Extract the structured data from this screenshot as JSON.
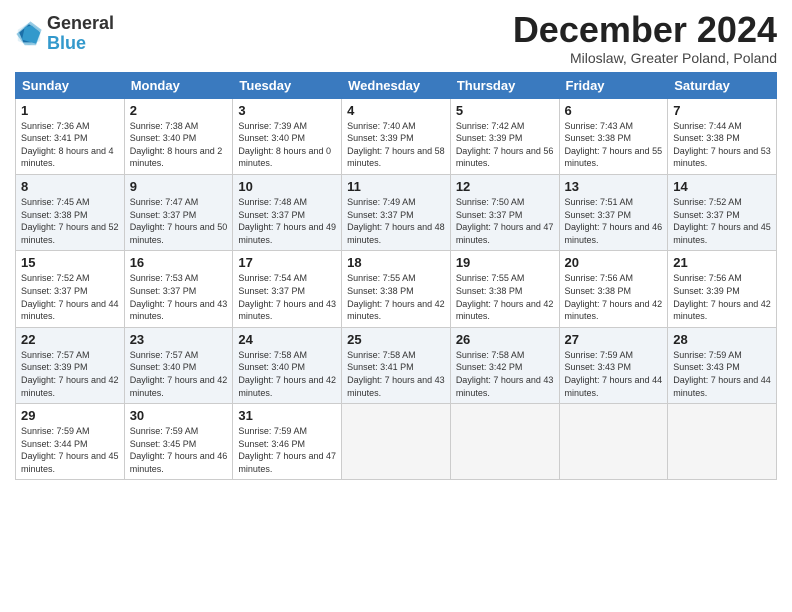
{
  "logo": {
    "general": "General",
    "blue": "Blue"
  },
  "header": {
    "month": "December 2024",
    "location": "Miloslaw, Greater Poland, Poland"
  },
  "weekdays": [
    "Sunday",
    "Monday",
    "Tuesday",
    "Wednesday",
    "Thursday",
    "Friday",
    "Saturday"
  ],
  "weeks": [
    [
      {
        "day": "1",
        "sunrise": "Sunrise: 7:36 AM",
        "sunset": "Sunset: 3:41 PM",
        "daylight": "Daylight: 8 hours and 4 minutes."
      },
      {
        "day": "2",
        "sunrise": "Sunrise: 7:38 AM",
        "sunset": "Sunset: 3:40 PM",
        "daylight": "Daylight: 8 hours and 2 minutes."
      },
      {
        "day": "3",
        "sunrise": "Sunrise: 7:39 AM",
        "sunset": "Sunset: 3:40 PM",
        "daylight": "Daylight: 8 hours and 0 minutes."
      },
      {
        "day": "4",
        "sunrise": "Sunrise: 7:40 AM",
        "sunset": "Sunset: 3:39 PM",
        "daylight": "Daylight: 7 hours and 58 minutes."
      },
      {
        "day": "5",
        "sunrise": "Sunrise: 7:42 AM",
        "sunset": "Sunset: 3:39 PM",
        "daylight": "Daylight: 7 hours and 56 minutes."
      },
      {
        "day": "6",
        "sunrise": "Sunrise: 7:43 AM",
        "sunset": "Sunset: 3:38 PM",
        "daylight": "Daylight: 7 hours and 55 minutes."
      },
      {
        "day": "7",
        "sunrise": "Sunrise: 7:44 AM",
        "sunset": "Sunset: 3:38 PM",
        "daylight": "Daylight: 7 hours and 53 minutes."
      }
    ],
    [
      {
        "day": "8",
        "sunrise": "Sunrise: 7:45 AM",
        "sunset": "Sunset: 3:38 PM",
        "daylight": "Daylight: 7 hours and 52 minutes."
      },
      {
        "day": "9",
        "sunrise": "Sunrise: 7:47 AM",
        "sunset": "Sunset: 3:37 PM",
        "daylight": "Daylight: 7 hours and 50 minutes."
      },
      {
        "day": "10",
        "sunrise": "Sunrise: 7:48 AM",
        "sunset": "Sunset: 3:37 PM",
        "daylight": "Daylight: 7 hours and 49 minutes."
      },
      {
        "day": "11",
        "sunrise": "Sunrise: 7:49 AM",
        "sunset": "Sunset: 3:37 PM",
        "daylight": "Daylight: 7 hours and 48 minutes."
      },
      {
        "day": "12",
        "sunrise": "Sunrise: 7:50 AM",
        "sunset": "Sunset: 3:37 PM",
        "daylight": "Daylight: 7 hours and 47 minutes."
      },
      {
        "day": "13",
        "sunrise": "Sunrise: 7:51 AM",
        "sunset": "Sunset: 3:37 PM",
        "daylight": "Daylight: 7 hours and 46 minutes."
      },
      {
        "day": "14",
        "sunrise": "Sunrise: 7:52 AM",
        "sunset": "Sunset: 3:37 PM",
        "daylight": "Daylight: 7 hours and 45 minutes."
      }
    ],
    [
      {
        "day": "15",
        "sunrise": "Sunrise: 7:52 AM",
        "sunset": "Sunset: 3:37 PM",
        "daylight": "Daylight: 7 hours and 44 minutes."
      },
      {
        "day": "16",
        "sunrise": "Sunrise: 7:53 AM",
        "sunset": "Sunset: 3:37 PM",
        "daylight": "Daylight: 7 hours and 43 minutes."
      },
      {
        "day": "17",
        "sunrise": "Sunrise: 7:54 AM",
        "sunset": "Sunset: 3:37 PM",
        "daylight": "Daylight: 7 hours and 43 minutes."
      },
      {
        "day": "18",
        "sunrise": "Sunrise: 7:55 AM",
        "sunset": "Sunset: 3:38 PM",
        "daylight": "Daylight: 7 hours and 42 minutes."
      },
      {
        "day": "19",
        "sunrise": "Sunrise: 7:55 AM",
        "sunset": "Sunset: 3:38 PM",
        "daylight": "Daylight: 7 hours and 42 minutes."
      },
      {
        "day": "20",
        "sunrise": "Sunrise: 7:56 AM",
        "sunset": "Sunset: 3:38 PM",
        "daylight": "Daylight: 7 hours and 42 minutes."
      },
      {
        "day": "21",
        "sunrise": "Sunrise: 7:56 AM",
        "sunset": "Sunset: 3:39 PM",
        "daylight": "Daylight: 7 hours and 42 minutes."
      }
    ],
    [
      {
        "day": "22",
        "sunrise": "Sunrise: 7:57 AM",
        "sunset": "Sunset: 3:39 PM",
        "daylight": "Daylight: 7 hours and 42 minutes."
      },
      {
        "day": "23",
        "sunrise": "Sunrise: 7:57 AM",
        "sunset": "Sunset: 3:40 PM",
        "daylight": "Daylight: 7 hours and 42 minutes."
      },
      {
        "day": "24",
        "sunrise": "Sunrise: 7:58 AM",
        "sunset": "Sunset: 3:40 PM",
        "daylight": "Daylight: 7 hours and 42 minutes."
      },
      {
        "day": "25",
        "sunrise": "Sunrise: 7:58 AM",
        "sunset": "Sunset: 3:41 PM",
        "daylight": "Daylight: 7 hours and 43 minutes."
      },
      {
        "day": "26",
        "sunrise": "Sunrise: 7:58 AM",
        "sunset": "Sunset: 3:42 PM",
        "daylight": "Daylight: 7 hours and 43 minutes."
      },
      {
        "day": "27",
        "sunrise": "Sunrise: 7:59 AM",
        "sunset": "Sunset: 3:43 PM",
        "daylight": "Daylight: 7 hours and 44 minutes."
      },
      {
        "day": "28",
        "sunrise": "Sunrise: 7:59 AM",
        "sunset": "Sunset: 3:43 PM",
        "daylight": "Daylight: 7 hours and 44 minutes."
      }
    ],
    [
      {
        "day": "29",
        "sunrise": "Sunrise: 7:59 AM",
        "sunset": "Sunset: 3:44 PM",
        "daylight": "Daylight: 7 hours and 45 minutes."
      },
      {
        "day": "30",
        "sunrise": "Sunrise: 7:59 AM",
        "sunset": "Sunset: 3:45 PM",
        "daylight": "Daylight: 7 hours and 46 minutes."
      },
      {
        "day": "31",
        "sunrise": "Sunrise: 7:59 AM",
        "sunset": "Sunset: 3:46 PM",
        "daylight": "Daylight: 7 hours and 47 minutes."
      },
      null,
      null,
      null,
      null
    ]
  ]
}
